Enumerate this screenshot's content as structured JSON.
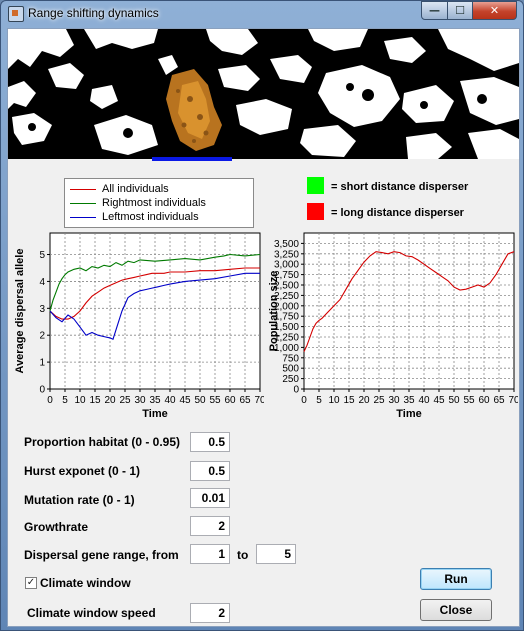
{
  "window": {
    "title": "Range shifting dynamics",
    "min_glyph": "—",
    "max_glyph": "☐",
    "close_glyph": "✕"
  },
  "legend": {
    "items": [
      {
        "label": "All individuals",
        "color": "#d40000"
      },
      {
        "label": "Rightmost individuals",
        "color": "#007a00"
      },
      {
        "label": "Leftmost individuals",
        "color": "#0000c8"
      }
    ]
  },
  "disperser_key": {
    "short": {
      "label": "= short distance disperser",
      "color": "#00ff00"
    },
    "long": {
      "label": "= long distance disperser",
      "color": "#ff0000"
    }
  },
  "chart_data": [
    {
      "type": "line",
      "xlabel": "Time",
      "ylabel": "Average dispersal allele",
      "xlim": [
        0,
        70
      ],
      "ylim": [
        0,
        5.8
      ],
      "xticks": [
        0,
        5,
        10,
        15,
        20,
        25,
        30,
        35,
        40,
        45,
        50,
        55,
        60,
        65,
        70
      ],
      "yticks": [
        0,
        1,
        2,
        3,
        4,
        5
      ],
      "grid": true,
      "series": [
        {
          "name": "All individuals",
          "color": "#d40000",
          "x": [
            0,
            2,
            4,
            6,
            8,
            10,
            12,
            14,
            16,
            18,
            20,
            22,
            24,
            26,
            28,
            30,
            32,
            34,
            36,
            38,
            40,
            45,
            50,
            55,
            60,
            65,
            70
          ],
          "y": [
            2.9,
            2.7,
            2.6,
            2.6,
            2.7,
            2.9,
            3.2,
            3.45,
            3.6,
            3.75,
            3.85,
            3.95,
            4.05,
            4.1,
            4.15,
            4.2,
            4.25,
            4.3,
            4.3,
            4.3,
            4.35,
            4.35,
            4.4,
            4.4,
            4.45,
            4.5,
            4.5
          ]
        },
        {
          "name": "Rightmost individuals",
          "color": "#007a00",
          "x": [
            0,
            1,
            2,
            3,
            4,
            5,
            6,
            8,
            10,
            12,
            14,
            16,
            18,
            20,
            22,
            24,
            26,
            28,
            30,
            35,
            40,
            45,
            50,
            55,
            58,
            60,
            65,
            70
          ],
          "y": [
            2.9,
            3.3,
            3.6,
            3.9,
            4.1,
            4.25,
            4.35,
            4.45,
            4.5,
            4.4,
            4.55,
            4.5,
            4.6,
            4.55,
            4.7,
            4.6,
            4.75,
            4.7,
            4.8,
            4.75,
            4.8,
            4.85,
            4.8,
            4.9,
            4.95,
            5.0,
            4.95,
            5.0
          ]
        },
        {
          "name": "Leftmost individuals",
          "color": "#0000c8",
          "x": [
            0,
            2,
            4,
            6,
            8,
            10,
            12,
            14,
            16,
            18,
            20,
            21,
            22,
            24,
            26,
            28,
            30,
            32,
            34,
            36,
            38,
            40,
            45,
            50,
            55,
            60,
            65,
            70
          ],
          "y": [
            2.9,
            2.65,
            2.5,
            2.75,
            2.6,
            2.3,
            2.0,
            2.1,
            2.0,
            1.95,
            1.9,
            1.85,
            2.2,
            2.9,
            3.4,
            3.55,
            3.65,
            3.7,
            3.75,
            3.8,
            3.85,
            3.9,
            4.0,
            4.05,
            4.1,
            4.2,
            4.3,
            4.3
          ]
        }
      ]
    },
    {
      "type": "line",
      "xlabel": "Time",
      "ylabel": "Population size",
      "xlim": [
        0,
        70
      ],
      "ylim": [
        0,
        3750
      ],
      "xticks": [
        0,
        5,
        10,
        15,
        20,
        25,
        30,
        35,
        40,
        45,
        50,
        55,
        60,
        65,
        70
      ],
      "yticks": [
        0,
        250,
        500,
        750,
        1000,
        1250,
        1500,
        1750,
        2000,
        2250,
        2500,
        2750,
        3000,
        3250,
        3500
      ],
      "grid": true,
      "series": [
        {
          "color": "#d40000",
          "x": [
            0,
            1,
            2,
            3,
            4,
            5,
            6,
            8,
            10,
            12,
            14,
            16,
            18,
            20,
            22,
            24,
            26,
            28,
            30,
            32,
            34,
            36,
            38,
            40,
            42,
            44,
            46,
            48,
            50,
            52,
            54,
            56,
            58,
            60,
            62,
            64,
            66,
            68,
            70
          ],
          "y": [
            900,
            1050,
            1250,
            1450,
            1580,
            1650,
            1700,
            1850,
            2000,
            2150,
            2400,
            2650,
            2850,
            3050,
            3200,
            3300,
            3280,
            3250,
            3300,
            3280,
            3200,
            3180,
            3100,
            3000,
            2900,
            2800,
            2700,
            2600,
            2450,
            2380,
            2400,
            2450,
            2500,
            2450,
            2550,
            2750,
            3000,
            3250,
            3300
          ]
        }
      ]
    }
  ],
  "form": {
    "proportion_habitat": {
      "label": "Proportion habitat (0 - 0.95)",
      "value": "0.5"
    },
    "hurst_exponent": {
      "label": "Hurst exponet (0 - 1)",
      "value": "0.5"
    },
    "mutation_rate": {
      "label": "Mutation rate (0 - 1)",
      "value": "0.01"
    },
    "growthrate": {
      "label": "Growthrate",
      "value": "2"
    },
    "dispersal_range": {
      "label": "Dispersal gene range, from",
      "from": "1",
      "to_label": "to",
      "to": "5"
    },
    "climate_window": {
      "label": "Climate window",
      "checked": true,
      "check_glyph": "✓"
    },
    "climate_window_speed": {
      "label": "Climate window speed",
      "value": "2"
    }
  },
  "buttons": {
    "run": "Run",
    "close": "Close"
  }
}
